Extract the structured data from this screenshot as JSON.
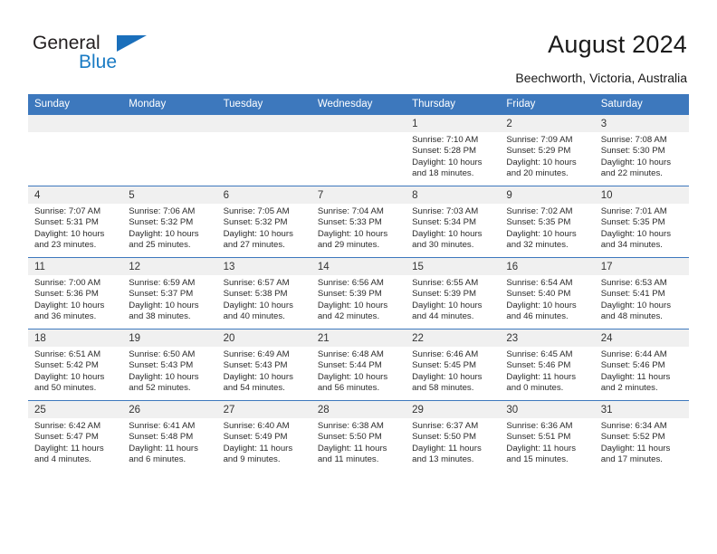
{
  "brand": {
    "name_top": "General",
    "name_bottom": "Blue",
    "triangle_color": "#1a6fbb",
    "blue_color": "#1a7bc4"
  },
  "header": {
    "title": "August 2024",
    "subtitle": "Beechworth, Victoria, Australia"
  },
  "calendar": {
    "header_bg": "#3d78bd",
    "daynum_bg": "#f0f0f0",
    "weekdays": [
      "Sunday",
      "Monday",
      "Tuesday",
      "Wednesday",
      "Thursday",
      "Friday",
      "Saturday"
    ],
    "labels": {
      "sunrise": "Sunrise:",
      "sunset": "Sunset:",
      "daylight": "Daylight:"
    },
    "weeks": [
      [
        {
          "day": "",
          "empty": true
        },
        {
          "day": "",
          "empty": true
        },
        {
          "day": "",
          "empty": true
        },
        {
          "day": "",
          "empty": true
        },
        {
          "day": "1",
          "sunrise": "Sunrise: 7:10 AM",
          "sunset": "Sunset: 5:28 PM",
          "daylight": "Daylight: 10 hours and 18 minutes."
        },
        {
          "day": "2",
          "sunrise": "Sunrise: 7:09 AM",
          "sunset": "Sunset: 5:29 PM",
          "daylight": "Daylight: 10 hours and 20 minutes."
        },
        {
          "day": "3",
          "sunrise": "Sunrise: 7:08 AM",
          "sunset": "Sunset: 5:30 PM",
          "daylight": "Daylight: 10 hours and 22 minutes."
        }
      ],
      [
        {
          "day": "4",
          "sunrise": "Sunrise: 7:07 AM",
          "sunset": "Sunset: 5:31 PM",
          "daylight": "Daylight: 10 hours and 23 minutes."
        },
        {
          "day": "5",
          "sunrise": "Sunrise: 7:06 AM",
          "sunset": "Sunset: 5:32 PM",
          "daylight": "Daylight: 10 hours and 25 minutes."
        },
        {
          "day": "6",
          "sunrise": "Sunrise: 7:05 AM",
          "sunset": "Sunset: 5:32 PM",
          "daylight": "Daylight: 10 hours and 27 minutes."
        },
        {
          "day": "7",
          "sunrise": "Sunrise: 7:04 AM",
          "sunset": "Sunset: 5:33 PM",
          "daylight": "Daylight: 10 hours and 29 minutes."
        },
        {
          "day": "8",
          "sunrise": "Sunrise: 7:03 AM",
          "sunset": "Sunset: 5:34 PM",
          "daylight": "Daylight: 10 hours and 30 minutes."
        },
        {
          "day": "9",
          "sunrise": "Sunrise: 7:02 AM",
          "sunset": "Sunset: 5:35 PM",
          "daylight": "Daylight: 10 hours and 32 minutes."
        },
        {
          "day": "10",
          "sunrise": "Sunrise: 7:01 AM",
          "sunset": "Sunset: 5:35 PM",
          "daylight": "Daylight: 10 hours and 34 minutes."
        }
      ],
      [
        {
          "day": "11",
          "sunrise": "Sunrise: 7:00 AM",
          "sunset": "Sunset: 5:36 PM",
          "daylight": "Daylight: 10 hours and 36 minutes."
        },
        {
          "day": "12",
          "sunrise": "Sunrise: 6:59 AM",
          "sunset": "Sunset: 5:37 PM",
          "daylight": "Daylight: 10 hours and 38 minutes."
        },
        {
          "day": "13",
          "sunrise": "Sunrise: 6:57 AM",
          "sunset": "Sunset: 5:38 PM",
          "daylight": "Daylight: 10 hours and 40 minutes."
        },
        {
          "day": "14",
          "sunrise": "Sunrise: 6:56 AM",
          "sunset": "Sunset: 5:39 PM",
          "daylight": "Daylight: 10 hours and 42 minutes."
        },
        {
          "day": "15",
          "sunrise": "Sunrise: 6:55 AM",
          "sunset": "Sunset: 5:39 PM",
          "daylight": "Daylight: 10 hours and 44 minutes."
        },
        {
          "day": "16",
          "sunrise": "Sunrise: 6:54 AM",
          "sunset": "Sunset: 5:40 PM",
          "daylight": "Daylight: 10 hours and 46 minutes."
        },
        {
          "day": "17",
          "sunrise": "Sunrise: 6:53 AM",
          "sunset": "Sunset: 5:41 PM",
          "daylight": "Daylight: 10 hours and 48 minutes."
        }
      ],
      [
        {
          "day": "18",
          "sunrise": "Sunrise: 6:51 AM",
          "sunset": "Sunset: 5:42 PM",
          "daylight": "Daylight: 10 hours and 50 minutes."
        },
        {
          "day": "19",
          "sunrise": "Sunrise: 6:50 AM",
          "sunset": "Sunset: 5:43 PM",
          "daylight": "Daylight: 10 hours and 52 minutes."
        },
        {
          "day": "20",
          "sunrise": "Sunrise: 6:49 AM",
          "sunset": "Sunset: 5:43 PM",
          "daylight": "Daylight: 10 hours and 54 minutes."
        },
        {
          "day": "21",
          "sunrise": "Sunrise: 6:48 AM",
          "sunset": "Sunset: 5:44 PM",
          "daylight": "Daylight: 10 hours and 56 minutes."
        },
        {
          "day": "22",
          "sunrise": "Sunrise: 6:46 AM",
          "sunset": "Sunset: 5:45 PM",
          "daylight": "Daylight: 10 hours and 58 minutes."
        },
        {
          "day": "23",
          "sunrise": "Sunrise: 6:45 AM",
          "sunset": "Sunset: 5:46 PM",
          "daylight": "Daylight: 11 hours and 0 minutes."
        },
        {
          "day": "24",
          "sunrise": "Sunrise: 6:44 AM",
          "sunset": "Sunset: 5:46 PM",
          "daylight": "Daylight: 11 hours and 2 minutes."
        }
      ],
      [
        {
          "day": "25",
          "sunrise": "Sunrise: 6:42 AM",
          "sunset": "Sunset: 5:47 PM",
          "daylight": "Daylight: 11 hours and 4 minutes."
        },
        {
          "day": "26",
          "sunrise": "Sunrise: 6:41 AM",
          "sunset": "Sunset: 5:48 PM",
          "daylight": "Daylight: 11 hours and 6 minutes."
        },
        {
          "day": "27",
          "sunrise": "Sunrise: 6:40 AM",
          "sunset": "Sunset: 5:49 PM",
          "daylight": "Daylight: 11 hours and 9 minutes."
        },
        {
          "day": "28",
          "sunrise": "Sunrise: 6:38 AM",
          "sunset": "Sunset: 5:50 PM",
          "daylight": "Daylight: 11 hours and 11 minutes."
        },
        {
          "day": "29",
          "sunrise": "Sunrise: 6:37 AM",
          "sunset": "Sunset: 5:50 PM",
          "daylight": "Daylight: 11 hours and 13 minutes."
        },
        {
          "day": "30",
          "sunrise": "Sunrise: 6:36 AM",
          "sunset": "Sunset: 5:51 PM",
          "daylight": "Daylight: 11 hours and 15 minutes."
        },
        {
          "day": "31",
          "sunrise": "Sunrise: 6:34 AM",
          "sunset": "Sunset: 5:52 PM",
          "daylight": "Daylight: 11 hours and 17 minutes."
        }
      ]
    ]
  }
}
